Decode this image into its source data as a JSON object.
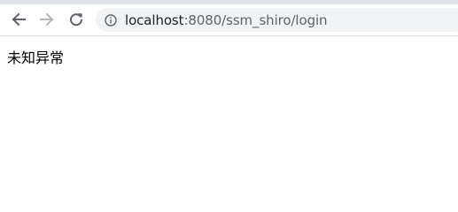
{
  "browser": {
    "address_bar": {
      "host": "localhost",
      "path": ":8080/ssm_shiro/login"
    }
  },
  "page": {
    "message": "未知异常"
  }
}
